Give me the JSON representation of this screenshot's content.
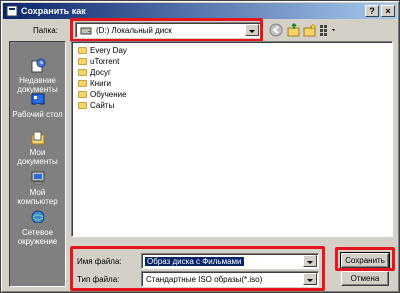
{
  "window": {
    "title": "Сохранить как",
    "help_label": "?",
    "close_label": "×"
  },
  "folder": {
    "label": "Папка:",
    "value": "(D:) Локальный диск"
  },
  "places": [
    {
      "label": "Недавние документы",
      "icon": "recent-documents-icon"
    },
    {
      "label": "Рабочий стол",
      "icon": "desktop-icon"
    },
    {
      "label": "Мои документы",
      "icon": "my-documents-icon"
    },
    {
      "label": "Мой компьютер",
      "icon": "my-computer-icon"
    },
    {
      "label": "Сетевое окружение",
      "icon": "network-icon"
    }
  ],
  "files": [
    "Every Day",
    "uTorrent",
    "Досуг",
    "Книги",
    "Обучение",
    "Сайты"
  ],
  "filename": {
    "label": "Имя файла:",
    "value": "Образ диска с Фильмами"
  },
  "filetype": {
    "label": "Тип файла:",
    "value": "Стандартные ISO образы(*.iso)"
  },
  "buttons": {
    "save": "Сохранить",
    "cancel": "Отмена"
  },
  "colors": {
    "title_start": "#0a246a",
    "title_end": "#a6caf0",
    "highlight": "#e8141c",
    "selection": "#0a246a"
  }
}
